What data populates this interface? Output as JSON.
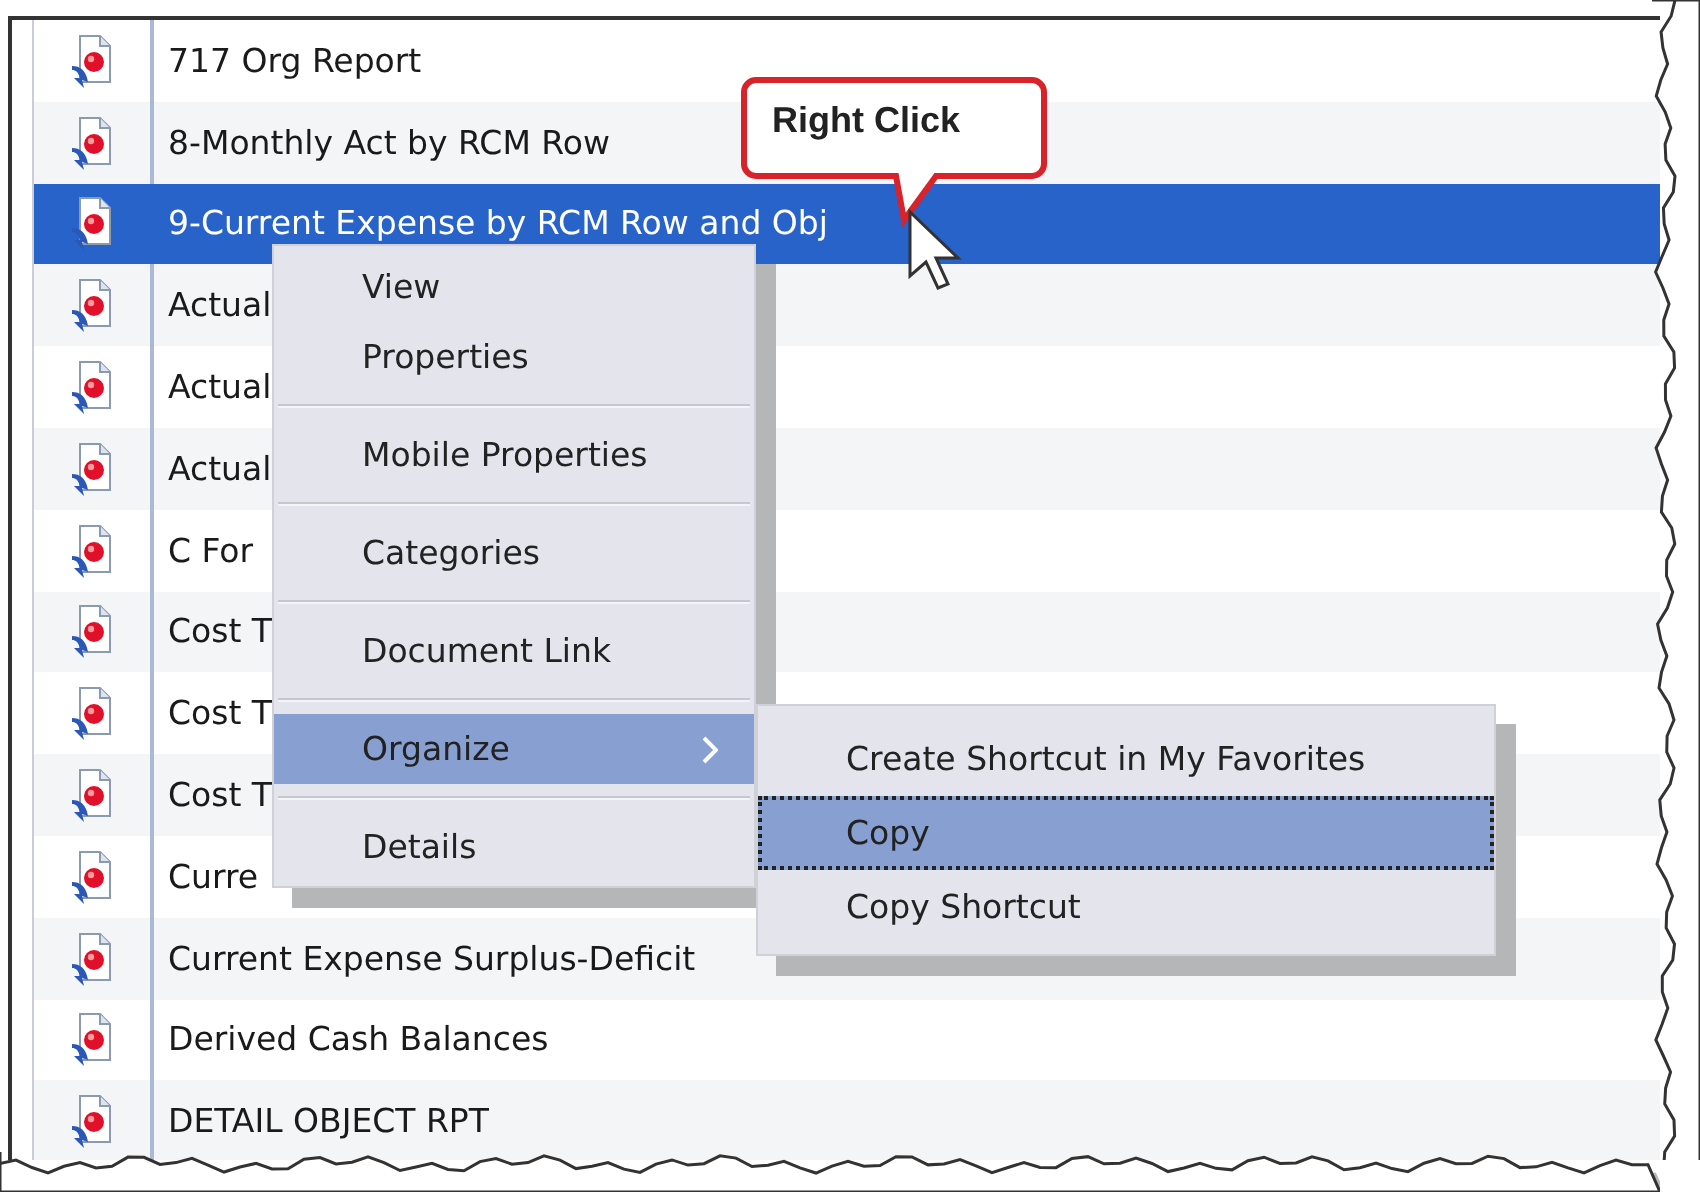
{
  "list": {
    "rows": [
      {
        "name": "717 Org Report",
        "selected": false
      },
      {
        "name": "8-Monthly Act by RCM Row",
        "selected": false
      },
      {
        "name": "9-Current Expense by RCM Row and Obj",
        "selected": true
      },
      {
        "name": "Actual",
        "selected": false
      },
      {
        "name": "Actual",
        "selected": false
      },
      {
        "name": "Actual",
        "selected": false
      },
      {
        "name": "C For",
        "selected": false
      },
      {
        "name": "Cost T",
        "selected": false
      },
      {
        "name": "Cost T",
        "selected": false
      },
      {
        "name": "Cost T",
        "selected": false
      },
      {
        "name": "Curre",
        "selected": false
      },
      {
        "name": "Current Expense Surplus-Deficit",
        "selected": false
      },
      {
        "name": "Derived Cash Balances",
        "selected": false
      },
      {
        "name": "DETAIL OBJECT RPT",
        "selected": false
      }
    ]
  },
  "context_menu": {
    "groups": [
      [
        {
          "label": "View",
          "selected": false,
          "submenu": false
        },
        {
          "label": "Properties",
          "selected": false,
          "submenu": false
        }
      ],
      [
        {
          "label": "Mobile Properties",
          "selected": false,
          "submenu": false
        }
      ],
      [
        {
          "label": "Categories",
          "selected": false,
          "submenu": false
        }
      ],
      [
        {
          "label": "Document Link",
          "selected": false,
          "submenu": false
        }
      ],
      [
        {
          "label": "Organize",
          "selected": true,
          "submenu": true
        }
      ],
      [
        {
          "label": "Details",
          "selected": false,
          "submenu": false
        }
      ]
    ]
  },
  "submenu": {
    "items": [
      {
        "label": "Create Shortcut in My Favorites",
        "selected": false
      },
      {
        "label": "Copy",
        "selected": true
      },
      {
        "label": "Copy Shortcut",
        "selected": false
      }
    ]
  },
  "callout": {
    "text": "Right Click"
  }
}
